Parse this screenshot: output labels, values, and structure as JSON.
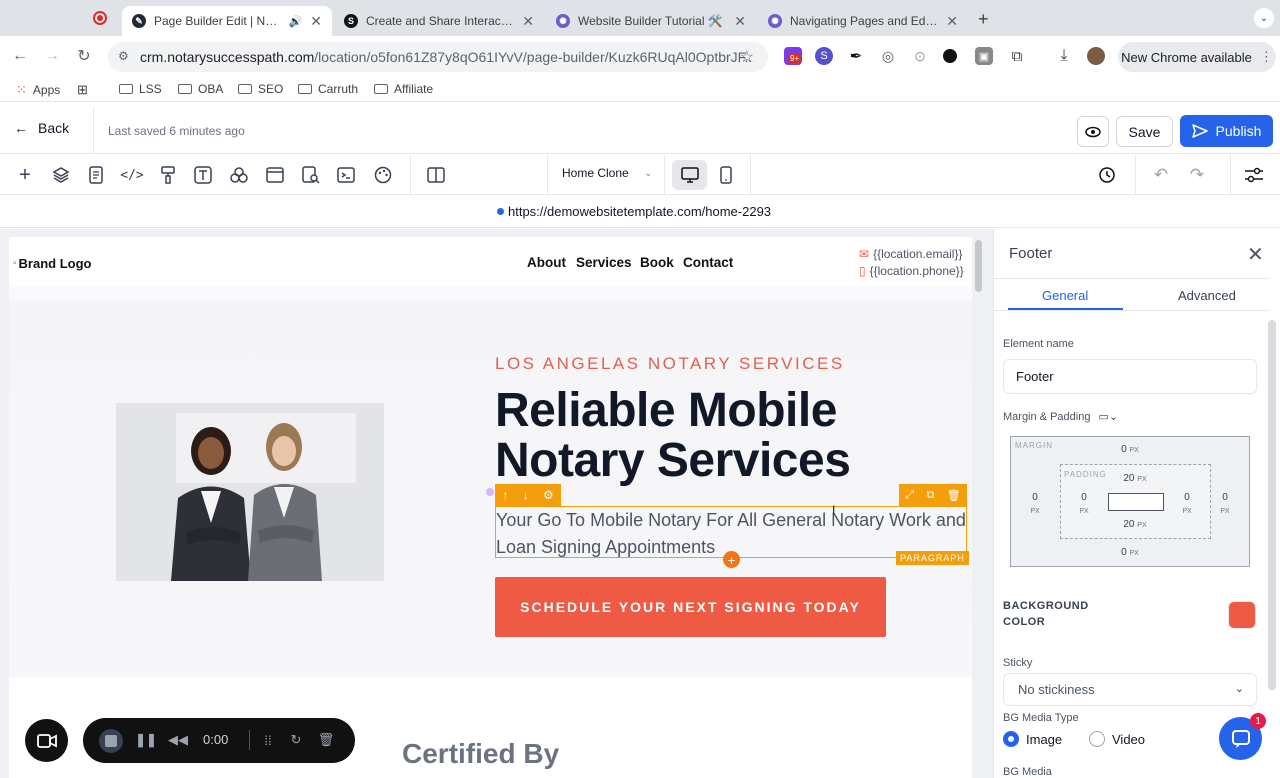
{
  "browser": {
    "tabs": [
      {
        "title": "Page Builder Edit | Notary",
        "active": true
      },
      {
        "title": "Create and Share Interactive",
        "active": false
      },
      {
        "title": "Website Builder Tutorial 🛠️",
        "active": false
      },
      {
        "title": "Navigating Pages and Editing",
        "active": false
      }
    ],
    "url_host": "crm.notarysuccesspath.com",
    "url_path": "/location/o5fon61Z87y8qO61IYvV/page-builder/Kuzk6RUqAl0OptbrJF...",
    "extension_badge": "9+",
    "new_chrome_label": "New Chrome available",
    "bookmarks": [
      "Apps",
      "LSS",
      "OBA",
      "SEO",
      "Carruth",
      "Affiliate"
    ]
  },
  "builder": {
    "back_label": "Back",
    "last_saved": "Last saved 6 minutes ago",
    "save_label": "Save",
    "publish_label": "Publish",
    "page_select": "Home Clone",
    "preview_url": "https://demowebsitetemplate.com/home-2293"
  },
  "site": {
    "brand_logo": "Brand Logo",
    "nav": [
      "About",
      "Services",
      "Book",
      "Contact"
    ],
    "email": "{{location.email}}",
    "phone": "{{location.phone}}",
    "kicker": "LOS ANGELAS NOTARY SERVICES",
    "headline_1": "Reliable Mobile",
    "headline_2": "Notary Services",
    "paragraph": "Your Go To Mobile Notary For All General Notary Work and Loan Signing Appointments",
    "paragraph_tag": "PARAGRAPH",
    "cta": "SCHEDULE YOUR NEXT SIGNING TODAY",
    "next_section_title": "Certified By"
  },
  "recorder": {
    "time": "0:00"
  },
  "panel": {
    "title": "Footer",
    "tabs": [
      "General",
      "Advanced"
    ],
    "element_name_label": "Element name",
    "element_name_value": "Footer",
    "margin_padding_label": "Margin & Padding",
    "margin_label": "MARGIN",
    "padding_label": "PADDING",
    "margin": {
      "top": "0",
      "right": "0",
      "bottom": "0",
      "left": "0"
    },
    "padding": {
      "top": "20",
      "right": "0",
      "bottom": "20",
      "left": "0"
    },
    "unit": "PX",
    "bg_color_label": "BACKGROUND COLOR",
    "bg_color": "#ef5a45",
    "sticky_label": "Sticky",
    "sticky_value": "No stickiness",
    "bg_media_type_label": "BG Media Type",
    "bg_media_options": [
      "Image",
      "Video"
    ],
    "bg_media_selected": "Image",
    "bg_media_label": "BG Media",
    "chat_badge": "1"
  },
  "colors": {
    "accent": "#2563eb",
    "brand_coral": "#ef5a45",
    "selection": "#f59e0b"
  }
}
